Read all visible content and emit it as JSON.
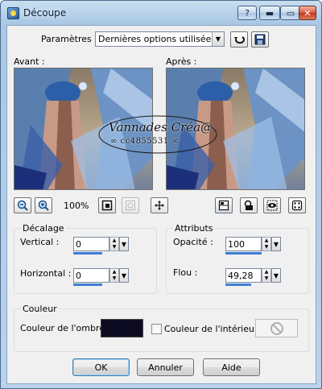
{
  "window": {
    "title": "Découpe"
  },
  "titlebar_buttons": {
    "help": "?",
    "minimize": "▬",
    "maximize": "▭",
    "close": "✕"
  },
  "params": {
    "label": "Paramètres :",
    "value": "Dernières options utilisées"
  },
  "preview": {
    "before_label": "Avant :",
    "after_label": "Après :",
    "watermark_line1": "Vannades Créa@",
    "watermark_line2": "∞ cc4855531 ∞"
  },
  "zoom": {
    "level": "100%"
  },
  "offset": {
    "title": "Décalage",
    "vertical_label": "Vertical :",
    "vertical_value": "0",
    "horizontal_label": "Horizontal :",
    "horizontal_value": "0"
  },
  "attributes": {
    "title": "Attributs",
    "opacity_label": "Opacité :",
    "opacity_value": "100",
    "blur_label": "Flou :",
    "blur_value": "49,28"
  },
  "color": {
    "title": "Couleur",
    "shadow_label": "Couleur de l'ombre :",
    "shadow_color": "#0c0b22",
    "interior_label": "Couleur de l'intérieur :"
  },
  "buttons": {
    "ok": "OK",
    "cancel": "Annuler",
    "help": "Aide"
  }
}
